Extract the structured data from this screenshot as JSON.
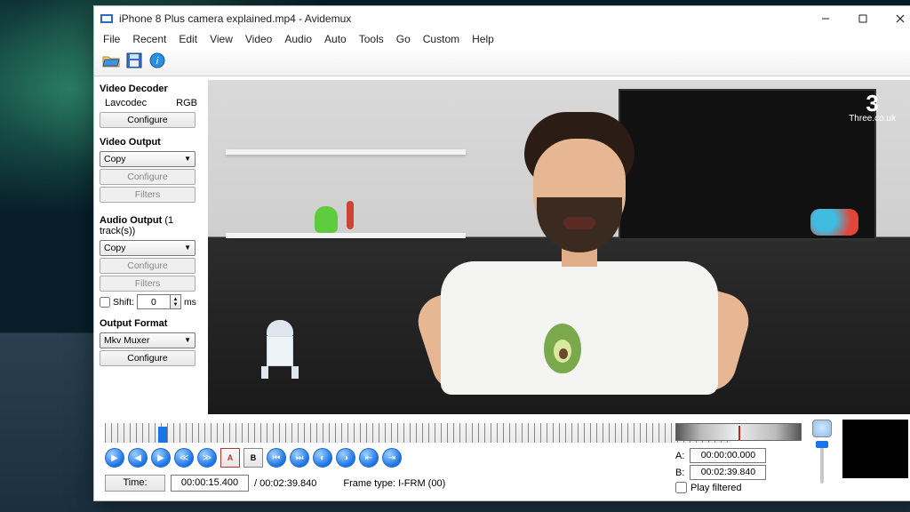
{
  "window": {
    "title": "iPhone 8 Plus camera explained.mp4 - Avidemux"
  },
  "menubar": [
    "File",
    "Recent",
    "Edit",
    "View",
    "Video",
    "Audio",
    "Auto",
    "Tools",
    "Go",
    "Custom",
    "Help"
  ],
  "sidebar": {
    "video_decoder_title": "Video Decoder",
    "decoder_codec": "Lavcodec",
    "decoder_colorspace": "RGB",
    "configure": "Configure",
    "video_output_title": "Video Output",
    "video_output_value": "Copy",
    "filters": "Filters",
    "audio_output_title": "Audio Output",
    "audio_output_tracks": "(1 track(s))",
    "audio_output_value": "Copy",
    "shift_label": "Shift:",
    "shift_value": "0",
    "shift_unit": "ms",
    "output_format_title": "Output Format",
    "output_format_value": "Mkv Muxer"
  },
  "preview": {
    "brand_big": "3",
    "brand_small": "Three.co.uk"
  },
  "time": {
    "button": "Time:",
    "current": "00:00:15.400",
    "total": "/ 00:02:39.840",
    "frame_type": "Frame type:  I-FRM (00)"
  },
  "ab": {
    "a_label": "A:",
    "a_value": "00:00:00.000",
    "b_label": "B:",
    "b_value": "00:02:39.840",
    "play_filtered": "Play filtered"
  }
}
